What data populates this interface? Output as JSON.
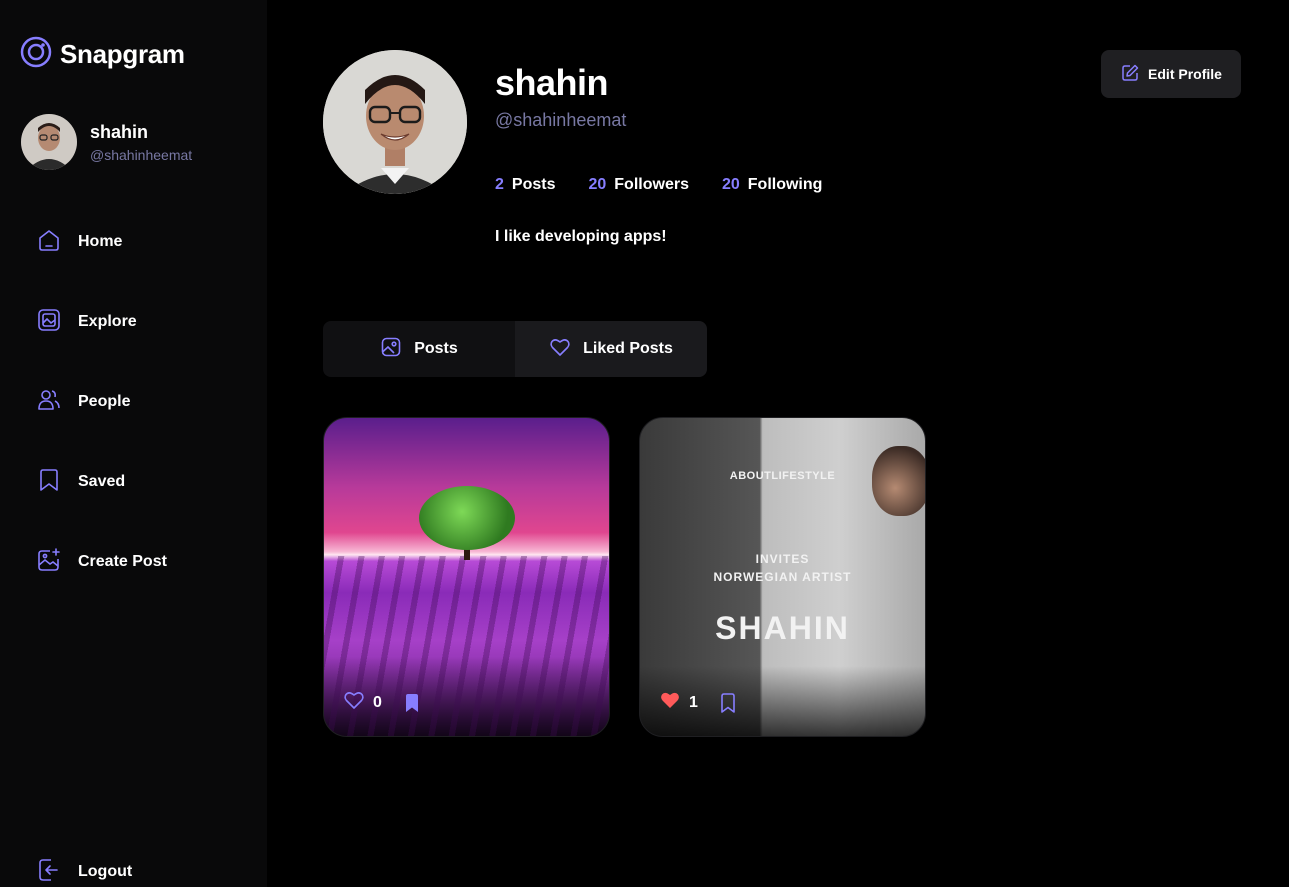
{
  "app": {
    "name": "Snapgram"
  },
  "sidebar": {
    "user": {
      "name": "shahin",
      "handle": "@shahinheemat"
    },
    "items": [
      {
        "label": "Home",
        "icon": "home-icon"
      },
      {
        "label": "Explore",
        "icon": "explore-icon"
      },
      {
        "label": "People",
        "icon": "people-icon"
      },
      {
        "label": "Saved",
        "icon": "bookmark-icon"
      },
      {
        "label": "Create Post",
        "icon": "create-post-icon"
      }
    ],
    "logout": {
      "label": "Logout",
      "icon": "logout-icon"
    }
  },
  "profile": {
    "name": "shahin",
    "handle": "@shahinheemat",
    "stats": [
      {
        "value": "2",
        "label": "Posts"
      },
      {
        "value": "20",
        "label": "Followers"
      },
      {
        "value": "20",
        "label": "Following"
      }
    ],
    "bio": "I like developing apps!",
    "edit_label": "Edit Profile"
  },
  "tabs": [
    {
      "label": "Posts",
      "icon": "posts-icon",
      "active": true
    },
    {
      "label": "Liked Posts",
      "icon": "heart-icon",
      "active": false
    }
  ],
  "posts": [
    {
      "likes": "0",
      "liked": false,
      "saved": true
    },
    {
      "likes": "1",
      "liked": true,
      "saved": false,
      "overlay": {
        "brand": "ABOUTLIFESTYLE",
        "line1": "INVITES",
        "line2": "NORWEGIAN ARTIST",
        "headline": "SHAHIN"
      }
    }
  ],
  "colors": {
    "accent": "#877EFF",
    "muted": "#7878A3",
    "like": "#FF5A5A",
    "sidebar_bg": "#09090A",
    "card_bg": "#1F1F22"
  }
}
